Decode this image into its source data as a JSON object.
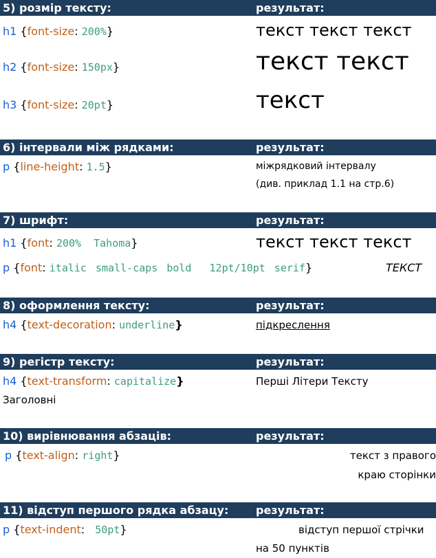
{
  "result_label": "результат:",
  "s5": {
    "title": "5) розмір тексту:",
    "rows": [
      {
        "sel": "h1",
        "prop": "font-size",
        "val": "200%",
        "result": "текст текст текст"
      },
      {
        "sel": "h2",
        "prop": "font-size",
        "val": "150px",
        "result": "текст текст"
      },
      {
        "sel": "h3",
        "prop": "font-size",
        "val": "20pt",
        "result": "текст"
      }
    ]
  },
  "s6": {
    "title": "6) інтервали між рядками:",
    "sel": "p",
    "prop": "line-height",
    "val": "1.5",
    "result_line1": "міжрядковий інтервалу",
    "result_line2": "(див. приклад 1.1 на стр.6)"
  },
  "s7": {
    "title": "7) шрифт:",
    "row1": {
      "sel": "h1",
      "prop": "font",
      "val": "200%  Tahoma",
      "result": "текст текст текст"
    },
    "row2": {
      "sel": "p",
      "prop": "font",
      "val": "italic small-caps bold  12pt/10pt serif",
      "result": "ТЕКСТ"
    }
  },
  "s8": {
    "title": "8) оформлення тексту:",
    "sel": "h4",
    "prop": "text-decoration",
    "val": "underline",
    "result": "підкреслення"
  },
  "s9": {
    "title": "9) регістр тексту:",
    "sel": "h4",
    "prop": "text-transform",
    "val": "capitalize",
    "result": "Перші Літери Тексту",
    "wrap": "Заголовні"
  },
  "s10": {
    "title": "10) вирівнювання абзаців:",
    "sel": "p",
    "prop": "text-align",
    "val": "right",
    "result_line1": "текст з правого",
    "result_line2": "краю сторінки"
  },
  "s11": {
    "title": "11) відступ першого рядка абзацу:",
    "sel": "p",
    "prop": "text-indent",
    "val": "50pt",
    "result_line1": "відступ першої стрічки",
    "result_line2": "на 50 пунктів"
  }
}
